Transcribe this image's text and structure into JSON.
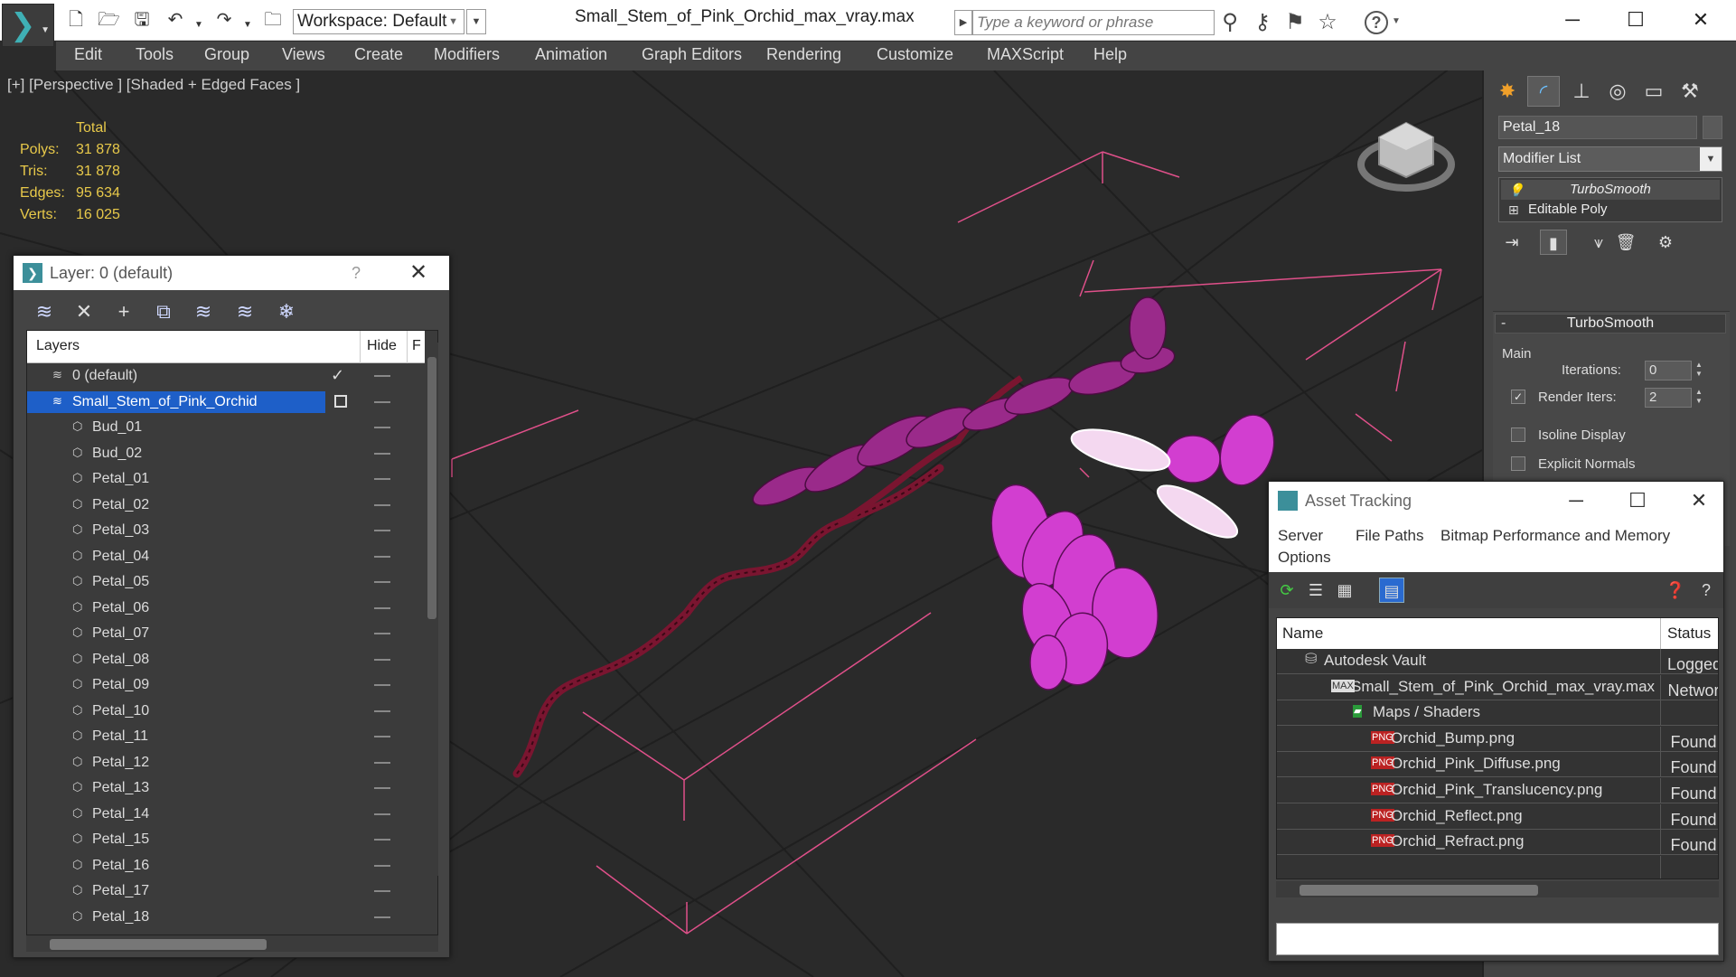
{
  "app": {
    "document_title": "Small_Stem_of_Pink_Orchid_max_vray.max",
    "workspace": "Workspace: Default",
    "search_placeholder": "Type a keyword or phrase"
  },
  "menu": [
    "Edit",
    "Tools",
    "Group",
    "Views",
    "Create",
    "Modifiers",
    "Animation",
    "Graph Editors",
    "Rendering",
    "Customize",
    "MAXScript",
    "Help"
  ],
  "viewport": {
    "label": "[+] [Perspective ] [Shaded + Edged Faces ]",
    "stats": {
      "total_label": "Total",
      "polys_label": "Polys:",
      "polys": "31 878",
      "tris_label": "Tris:",
      "tris": "31 878",
      "edges_label": "Edges:",
      "edges": "95 634",
      "verts_label": "Verts:",
      "verts": "16 025"
    },
    "wire_color": "#e0508a",
    "stem_color": "#7a1530",
    "petal_color": "#d23ed0"
  },
  "command_panel": {
    "object_name": "Petal_18",
    "modifier_list": "Modifier List",
    "stack": [
      "TurboSmooth",
      "Editable Poly"
    ],
    "rollout_title": "TurboSmooth",
    "group_main": "Main",
    "iterations_label": "Iterations:",
    "iterations": "0",
    "render_iters_label": "Render Iters:",
    "render_iters": "2",
    "isoline_label": "Isoline Display",
    "explicit_label": "Explicit Normals"
  },
  "layer_dialog": {
    "title": "Layer: 0 (default)",
    "help": "?",
    "col_layers": "Layers",
    "col_hide": "Hide",
    "col_f": "F",
    "layers": [
      {
        "name": "0 (default)",
        "level": 0,
        "kind": "layer"
      },
      {
        "name": "Small_Stem_of_Pink_Orchid",
        "level": 0,
        "kind": "layer",
        "selected": true
      },
      {
        "name": "Bud_01",
        "level": 1,
        "kind": "object"
      },
      {
        "name": "Bud_02",
        "level": 1,
        "kind": "object"
      },
      {
        "name": "Petal_01",
        "level": 1,
        "kind": "object"
      },
      {
        "name": "Petal_02",
        "level": 1,
        "kind": "object"
      },
      {
        "name": "Petal_03",
        "level": 1,
        "kind": "object"
      },
      {
        "name": "Petal_04",
        "level": 1,
        "kind": "object"
      },
      {
        "name": "Petal_05",
        "level": 1,
        "kind": "object"
      },
      {
        "name": "Petal_06",
        "level": 1,
        "kind": "object"
      },
      {
        "name": "Petal_07",
        "level": 1,
        "kind": "object"
      },
      {
        "name": "Petal_08",
        "level": 1,
        "kind": "object"
      },
      {
        "name": "Petal_09",
        "level": 1,
        "kind": "object"
      },
      {
        "name": "Petal_10",
        "level": 1,
        "kind": "object"
      },
      {
        "name": "Petal_11",
        "level": 1,
        "kind": "object"
      },
      {
        "name": "Petal_12",
        "level": 1,
        "kind": "object"
      },
      {
        "name": "Petal_13",
        "level": 1,
        "kind": "object"
      },
      {
        "name": "Petal_14",
        "level": 1,
        "kind": "object"
      },
      {
        "name": "Petal_15",
        "level": 1,
        "kind": "object"
      },
      {
        "name": "Petal_16",
        "level": 1,
        "kind": "object"
      },
      {
        "name": "Petal_17",
        "level": 1,
        "kind": "object"
      },
      {
        "name": "Petal_18",
        "level": 1,
        "kind": "object"
      }
    ]
  },
  "asset_tracking": {
    "title": "Asset Tracking",
    "menu": [
      "Server",
      "File",
      "Paths",
      "Bitmap Performance and Memory",
      "Options"
    ],
    "col_name": "Name",
    "col_status": "Status",
    "rows": [
      {
        "name": "Autodesk Vault",
        "level": 0,
        "icon": "vault",
        "status": "Logged"
      },
      {
        "name": "Small_Stem_of_Pink_Orchid_max_vray.max",
        "level": 1,
        "icon": "max",
        "status": "Networ"
      },
      {
        "name": "Maps / Shaders",
        "level": 2,
        "icon": "maps",
        "status": ""
      },
      {
        "name": "Orchid_Bump.png",
        "level": 3,
        "icon": "png",
        "status": "Found"
      },
      {
        "name": "Orchid_Pink_Diffuse.png",
        "level": 3,
        "icon": "png",
        "status": "Found"
      },
      {
        "name": "Orchid_Pink_Translucency.png",
        "level": 3,
        "icon": "png",
        "status": "Found"
      },
      {
        "name": "Orchid_Reflect.png",
        "level": 3,
        "icon": "png",
        "status": "Found"
      },
      {
        "name": "Orchid_Refract.png",
        "level": 3,
        "icon": "png",
        "status": "Found"
      }
    ]
  }
}
